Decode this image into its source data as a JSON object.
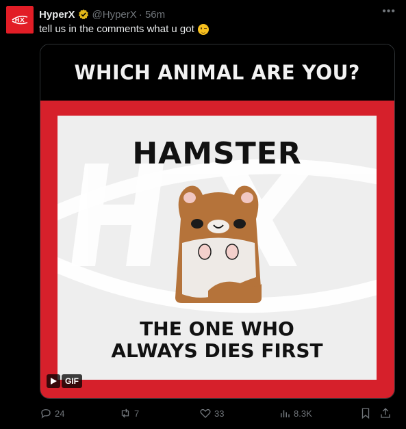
{
  "author": {
    "name": "HyperX",
    "handle": "@HyperX",
    "time": "· 56m",
    "verified": true
  },
  "tweet": {
    "text": "tell us in the comments what u got",
    "emoji": "winking-face"
  },
  "media": {
    "headline": "WHICH ANIMAL ARE YOU?",
    "result": "HAMSTER",
    "caption_line1": "THE ONE WHO",
    "caption_line2": "ALWAYS DIES FIRST",
    "badge": "GIF"
  },
  "actions": {
    "replies": "24",
    "reposts": "7",
    "likes": "33",
    "views": "8.3K"
  },
  "colors": {
    "brand_red": "#e21d26",
    "card_red": "#d6202b",
    "muted": "#71767b",
    "text": "#e7e9ea",
    "verified_gold": "#e2b719"
  }
}
